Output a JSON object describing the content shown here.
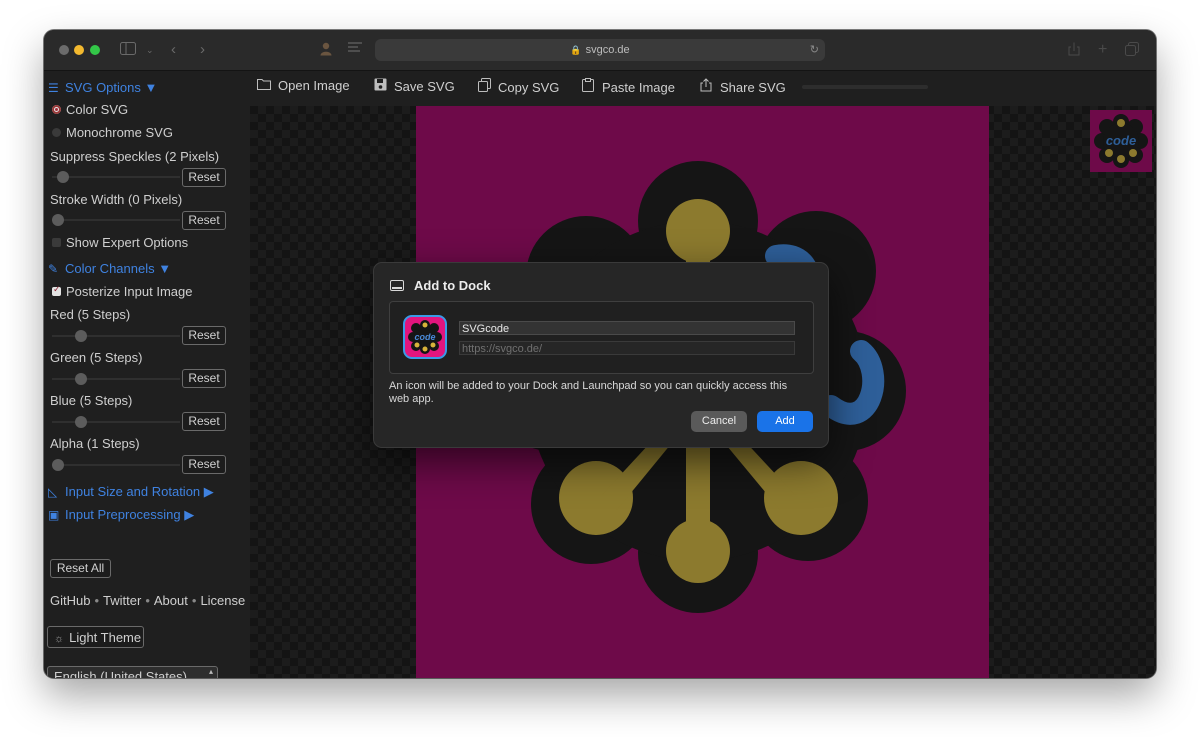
{
  "browser": {
    "address": "svgco.de"
  },
  "sidebar": {
    "svg_options_label": "SVG Options ▼",
    "color_svg_label": "Color SVG",
    "monochrome_svg_label": "Monochrome SVG",
    "suppress_speckles_label": "Suppress Speckles (2 Pixels)",
    "stroke_width_label": "Stroke Width (0 Pixels)",
    "show_expert_label": "Show Expert Options",
    "color_channels_label": "Color Channels ▼",
    "posterize_label": "Posterize Input Image",
    "red_label": "Red (5 Steps)",
    "green_label": "Green (5 Steps)",
    "blue_label": "Blue (5 Steps)",
    "alpha_label": "Alpha (1 Steps)",
    "reset_label": "Reset",
    "input_size_label": "Input Size and Rotation ▶",
    "input_preprocessing_label": "Input Preprocessing ▶",
    "reset_all_label": "Reset All",
    "links": {
      "github": "GitHub",
      "twitter": "Twitter",
      "about": "About",
      "license": "License",
      "separator": "•"
    },
    "theme_button_label": "Light Theme",
    "language_value": "English (United States)"
  },
  "toolbar": {
    "open_image": "Open Image",
    "save_svg": "Save SVG",
    "copy_svg": "Copy SVG",
    "paste_image": "Paste Image",
    "share_svg": "Share SVG"
  },
  "artwork": {
    "text": "code",
    "colors": {
      "background": "#6e0a49",
      "outline": "#151515",
      "petal": "#8c7a2e",
      "letters": "#2e5f99"
    }
  },
  "dialog": {
    "title": "Add to Dock",
    "app_name": "SVGcode",
    "app_url": "https://svgco.de/",
    "description": "An icon will be added to your Dock and Launchpad so you can quickly access this web app.",
    "cancel_label": "Cancel",
    "add_label": "Add",
    "icon_text": "code"
  },
  "theme": {
    "accent": "#3f82e0",
    "primary_button": "#1a73e8"
  }
}
